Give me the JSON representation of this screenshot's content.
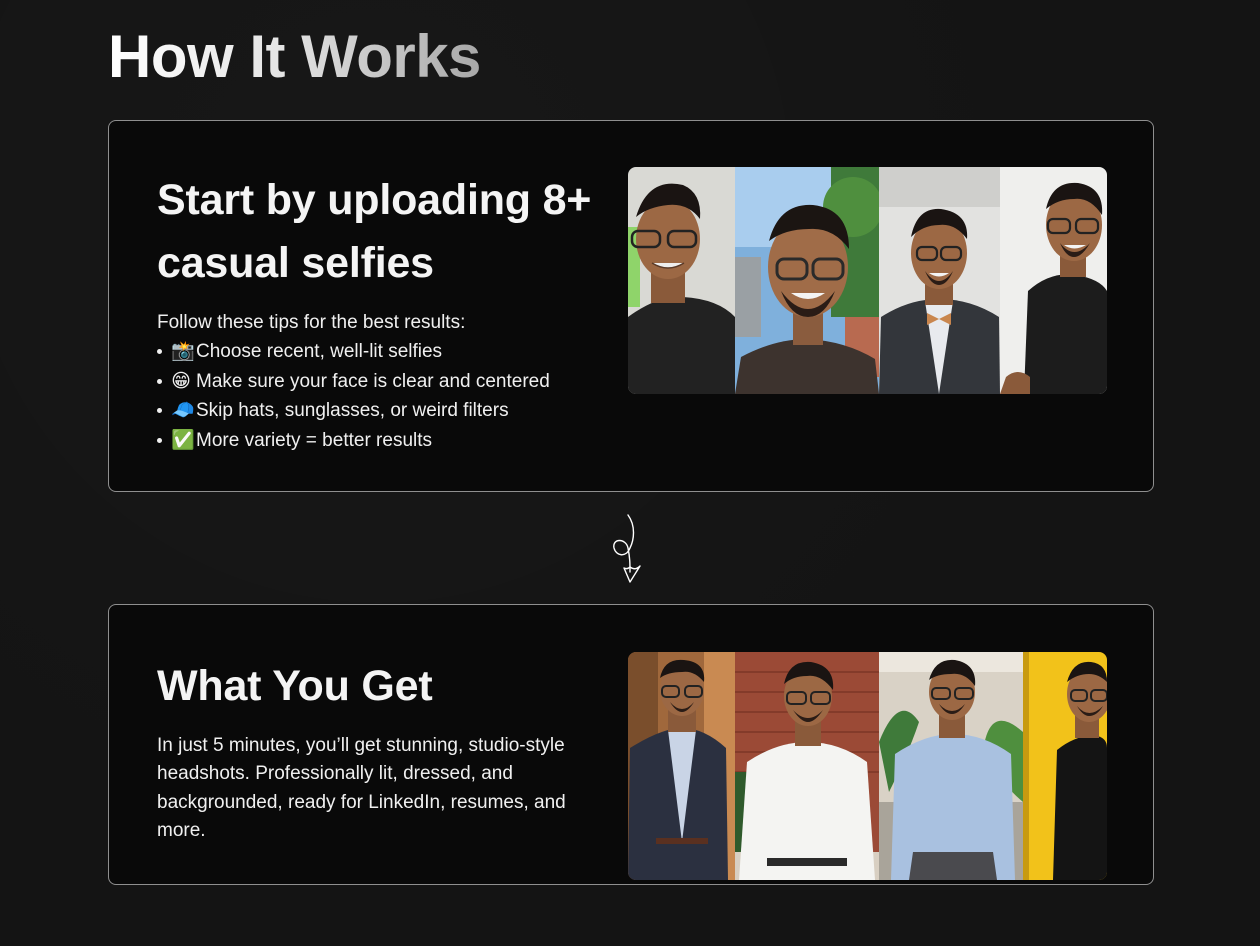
{
  "section": {
    "title": "How It Works"
  },
  "step_upload": {
    "heading": "Start by uploading 8+ casual selfies",
    "tips_intro": "Follow these tips for the best results:",
    "tips": [
      {
        "icon": "camera-flash-icon",
        "glyph": "📸",
        "text": "Choose recent, well-lit selfies"
      },
      {
        "icon": "grinning-face-icon",
        "glyph": "😁",
        "text": "Make sure your face is clear and centered"
      },
      {
        "icon": "cap-icon",
        "glyph": "🧢",
        "text": "Skip hats, sunglasses, or weird filters"
      },
      {
        "icon": "check-mark-icon",
        "glyph": "✅",
        "text": "More variety = better results"
      }
    ]
  },
  "step_result": {
    "heading": "What You Get",
    "description": "In just 5 minutes, you’ll get stunning, studio-style headshots. Professionally lit, dressed, and backgrounded, ready for LinkedIn, resumes, and more."
  },
  "colors": {
    "background": "#141414",
    "card_background": "#090909",
    "card_border": "#8f8f8f",
    "text": "#f0f0f0",
    "yellow_backdrop": "#f2c21a"
  }
}
